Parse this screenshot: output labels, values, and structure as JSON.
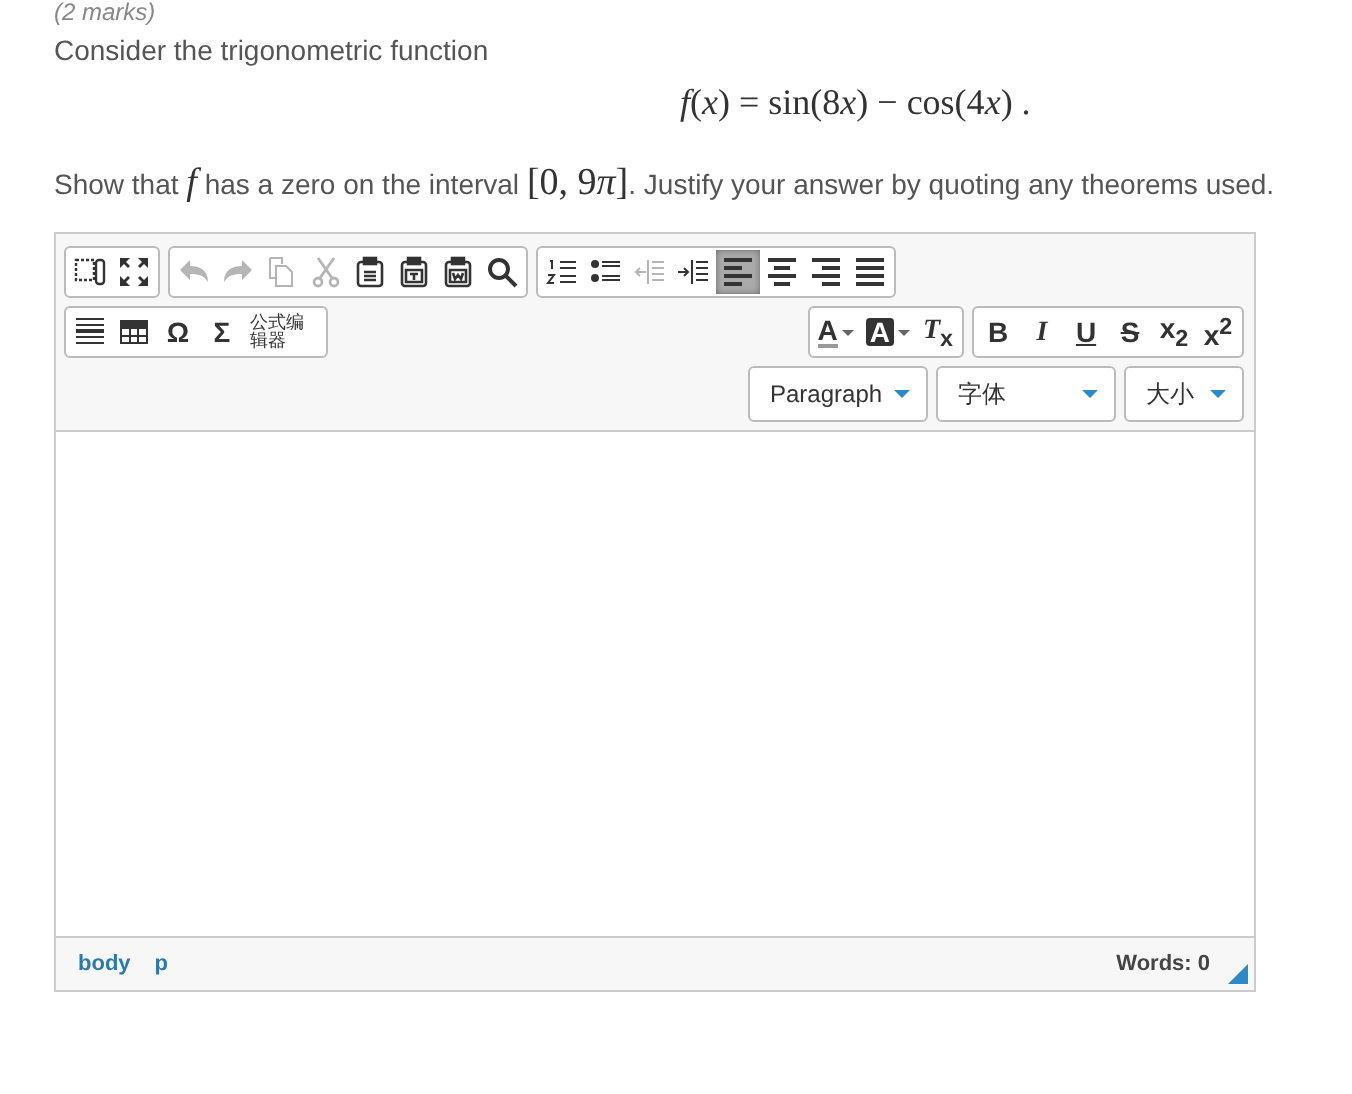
{
  "marks": "(2 marks)",
  "intro": "Consider the trigonometric function",
  "formula": [
    {
      "text": "f",
      "italic": true
    },
    {
      "text": "(",
      "italic": false
    },
    {
      "text": "x",
      "italic": true
    },
    {
      "text": ") = sin(8",
      "italic": false
    },
    {
      "text": "x",
      "italic": true
    },
    {
      "text": ") − cos(4",
      "italic": false
    },
    {
      "text": "x",
      "italic": true
    },
    {
      "text": ") .",
      "italic": false
    }
  ],
  "question": [
    {
      "text": "Show that ",
      "math": false,
      "italic": false
    },
    {
      "text": "f",
      "math": true,
      "italic": true
    },
    {
      "text": " has a zero on the interval ",
      "math": false,
      "italic": false
    },
    {
      "text": "[0, 9",
      "math": true,
      "italic": false
    },
    {
      "text": "π",
      "math": true,
      "italic": true
    },
    {
      "text": "]",
      "math": true,
      "italic": false
    },
    {
      "text": ". Justify your answer by quoting any theorems used.",
      "math": false,
      "italic": false
    }
  ],
  "toolbar_rows": [
    {
      "groups": [
        [
          {
            "kind": "source",
            "disabled": false,
            "selected": false
          },
          {
            "kind": "fullscreen",
            "disabled": false,
            "selected": false
          }
        ],
        [
          {
            "kind": "undo",
            "disabled": true,
            "selected": false
          },
          {
            "kind": "redo",
            "disabled": true,
            "selected": false
          },
          {
            "kind": "copy",
            "disabled": true,
            "selected": false
          },
          {
            "kind": "cut",
            "disabled": true,
            "selected": false
          },
          {
            "kind": "paste",
            "disabled": false,
            "selected": false
          },
          {
            "kind": "pastetext",
            "disabled": false,
            "selected": false
          },
          {
            "kind": "pasteword",
            "disabled": false,
            "selected": false
          },
          {
            "kind": "search",
            "disabled": false,
            "selected": false
          }
        ],
        [
          {
            "kind": "ol",
            "disabled": false,
            "selected": false
          },
          {
            "kind": "ul",
            "disabled": false,
            "selected": false
          },
          {
            "kind": "outdent",
            "disabled": true,
            "selected": false
          },
          {
            "kind": "indent",
            "disabled": false,
            "selected": false
          },
          {
            "kind": "alignleft",
            "disabled": false,
            "selected": true
          },
          {
            "kind": "aligncenter",
            "disabled": false,
            "selected": false
          },
          {
            "kind": "alignright",
            "disabled": false,
            "selected": false
          },
          {
            "kind": "justify",
            "disabled": false,
            "selected": false
          }
        ]
      ]
    },
    {
      "groups": [
        [
          {
            "kind": "hr",
            "disabled": false,
            "selected": false
          },
          {
            "kind": "table",
            "disabled": false,
            "selected": false
          },
          {
            "kind": "text",
            "label": "Ω",
            "disabled": false,
            "selected": false
          },
          {
            "kind": "text",
            "label": "Σ",
            "disabled": false,
            "selected": false
          },
          {
            "kind": "formula",
            "label": "公式编辑器",
            "disabled": false,
            "selected": false
          }
        ],
        [
          {
            "kind": "color",
            "label": "A",
            "disabled": false,
            "selected": false
          },
          {
            "kind": "bgcolor",
            "label": "A",
            "disabled": false,
            "selected": false
          },
          {
            "kind": "text",
            "label": "*T*$_{x}$",
            "disabled": false,
            "selected": false
          }
        ],
        [
          {
            "kind": "text",
            "label": "**B**",
            "disabled": false,
            "selected": false
          },
          {
            "kind": "text",
            "label": "*I*",
            "disabled": false,
            "selected": false
          },
          {
            "kind": "underline",
            "label": "U",
            "disabled": false,
            "selected": false
          },
          {
            "kind": "strike",
            "label": "S",
            "disabled": false,
            "selected": false
          },
          {
            "kind": "text",
            "label": "x$_{2}$",
            "disabled": false,
            "selected": false
          },
          {
            "kind": "text",
            "label": "x$^{2}$",
            "disabled": false,
            "selected": false
          }
        ]
      ]
    }
  ],
  "dropdowns": [
    {
      "label": "Paragraph"
    },
    {
      "label": "字体"
    },
    {
      "label": "大小"
    }
  ],
  "status_bar": {
    "path": [
      "body",
      "p"
    ],
    "words": "Words: 0"
  }
}
